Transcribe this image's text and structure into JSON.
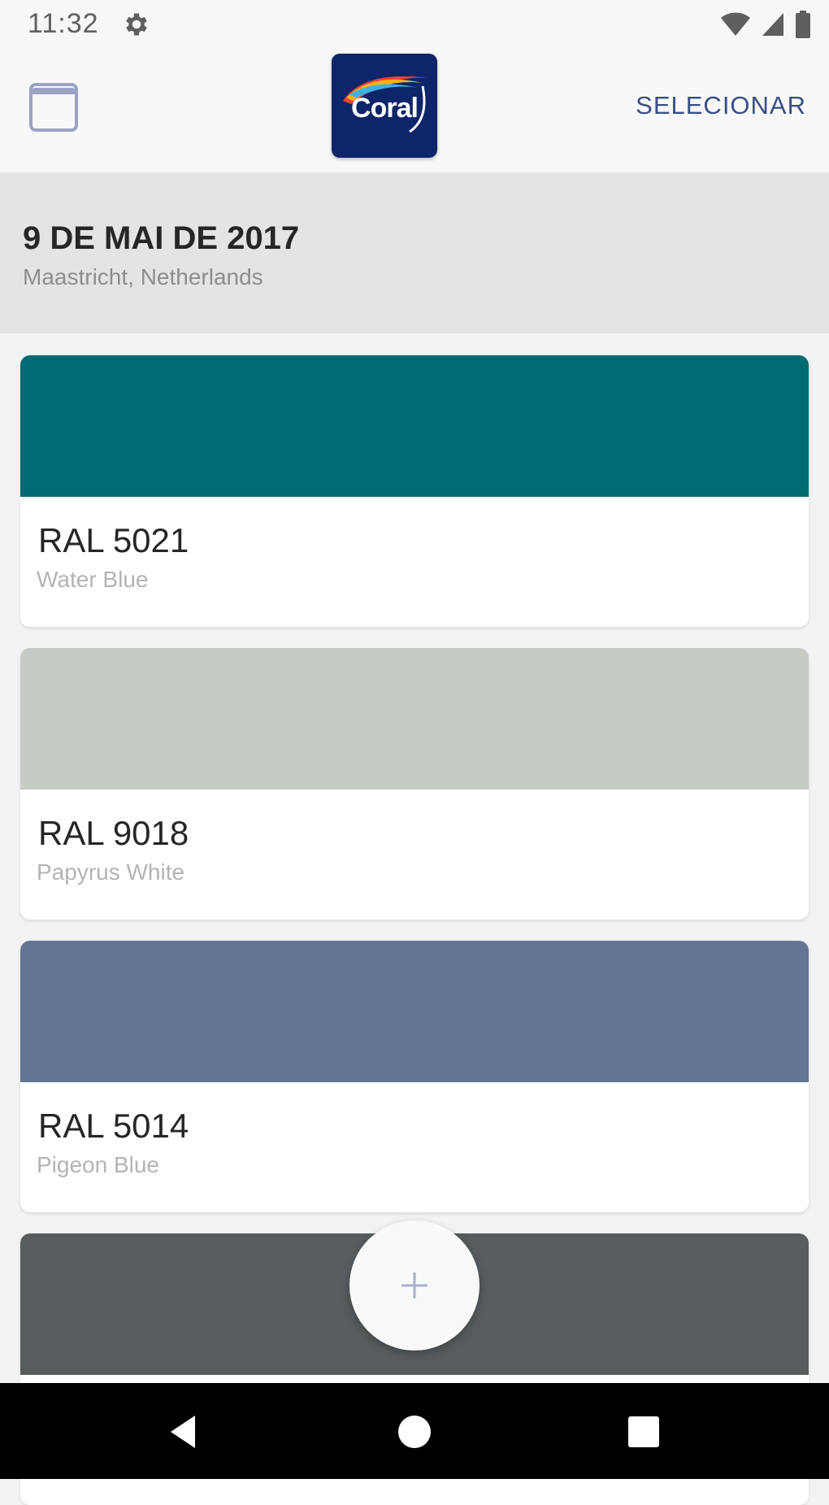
{
  "status_bar": {
    "time": "11:32",
    "icons": [
      "settings-gear-icon",
      "wifi-icon",
      "cell-signal-icon",
      "battery-icon"
    ]
  },
  "app_bar": {
    "logo_text": "Coral",
    "select_label": "SELECIONAR",
    "calendar_icon": "calendar-icon"
  },
  "date_header": {
    "date": "9 DE MAI DE 2017",
    "location": "Maastricht, Netherlands"
  },
  "colors": [
    {
      "code": "RAL 5021",
      "name": "Water Blue",
      "hex": "#006b72"
    },
    {
      "code": "RAL 9018",
      "name": "Papyrus White",
      "hex": "#c6cbc5"
    },
    {
      "code": "RAL 5014",
      "name": "Pigeon Blue",
      "hex": "#637593"
    },
    {
      "code": "",
      "name": "",
      "hex": "#575c5e"
    }
  ],
  "fab": {
    "icon": "plus-icon"
  },
  "nav_bar": {
    "icons": [
      "back-icon",
      "home-icon",
      "recents-icon"
    ]
  },
  "theme": {
    "accent": "#3a4e86",
    "logo_bg": "#0e2569"
  }
}
